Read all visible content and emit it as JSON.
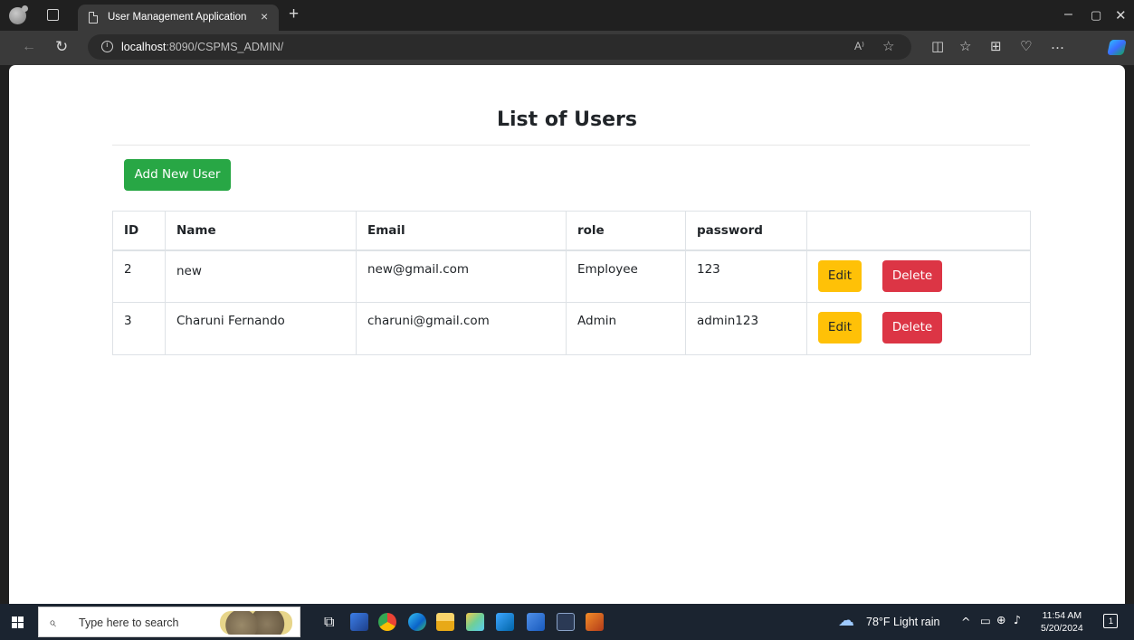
{
  "browser": {
    "tab_title": "User Management Application",
    "tab_close": "×",
    "new_tab": "+",
    "url_host": "localhost",
    "url_rest": ":8090/CSPMS_ADMIN/",
    "read_aloud": "A⁾",
    "window_controls": {
      "minimize": "–",
      "maximize": "▢",
      "close": "✕"
    }
  },
  "page": {
    "title": "List of Users",
    "add_button_label": "Add New User",
    "table": {
      "headers": [
        "ID",
        "Name",
        "Email",
        "role",
        "password",
        ""
      ],
      "rows": [
        {
          "id": "2",
          "name": "new",
          "email": "new@gmail.com",
          "role": "Employee",
          "password": "123"
        },
        {
          "id": "3",
          "name": "Charuni Fernando",
          "email": "charuni@gmail.com",
          "role": "Admin",
          "password": "admin123"
        }
      ],
      "edit_label": "Edit",
      "delete_label": "Delete"
    },
    "colors": {
      "add": "#28a745",
      "edit": "#ffc107",
      "delete": "#dc3545"
    }
  },
  "taskbar": {
    "search_placeholder": "Type here to search",
    "weather": "78°F  Light rain",
    "time": "11:54 AM",
    "date": "5/20/2024",
    "notification_count": "1",
    "apps": [
      "task-view-icon",
      "terminal-icon",
      "chrome-icon",
      "edge-icon",
      "file-explorer-icon",
      "paint-icon",
      "vscode-icon",
      "word-icon",
      "ssms-icon",
      "xampp-icon"
    ]
  }
}
